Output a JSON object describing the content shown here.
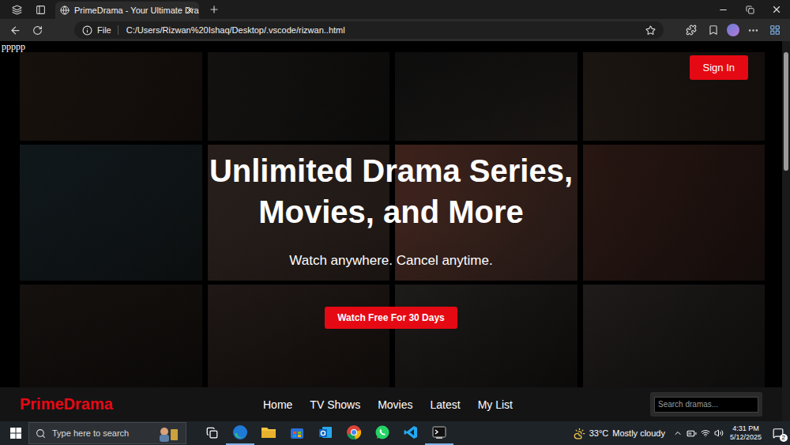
{
  "browser": {
    "tab_title": "PrimeDrama - Your Ultimate Dra",
    "address_scheme": "File",
    "address": "C:/Users/Rizwan%20Ishaq/Desktop/.vscode/rizwan..html"
  },
  "page": {
    "stray_text": "ppppp",
    "sign_in": "Sign In",
    "hero": {
      "title": "Unlimited Drama Series, Movies, and More",
      "subtitle": "Watch anywhere. Cancel anytime.",
      "cta": "Watch Free For 30 Days"
    },
    "nav": {
      "logo": "PrimeDrama",
      "links": [
        "Home",
        "TV Shows",
        "Movies",
        "Latest",
        "My List"
      ],
      "search_placeholder": "Search dramas..."
    }
  },
  "taskbar": {
    "search_placeholder": "Type here to search",
    "weather": {
      "temp": "33°C",
      "condition": "Mostly cloudy"
    },
    "clock": {
      "time": "4:31 PM",
      "date": "5/12/2025"
    },
    "notifications": "2"
  }
}
